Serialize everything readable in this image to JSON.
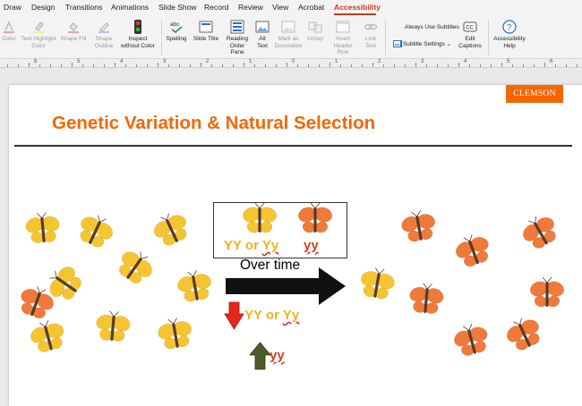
{
  "tabs": [
    "Draw",
    "Design",
    "Transitions",
    "Animations",
    "Slide Show",
    "Record",
    "Review",
    "View",
    "Acrobat",
    "Accessibility"
  ],
  "active_tab": "Accessibility",
  "ribbon": {
    "color_label": "Color",
    "text_highlight_color": "Text Highlight Color",
    "shape_fill": "Shape Fill",
    "shape_outline": "Shape Outline",
    "inspect_without_color": "Inspect without Color",
    "spelling": "Spelling",
    "spelling_icon_text": "abc",
    "slide_title": "Slide Title",
    "reading_order_pane": "Reading Order Pane",
    "alt_text": "Alt Text",
    "mark_as_decorative": "Mark as Decorative",
    "group": "Group",
    "insert_header_row": "Insert Header Row",
    "link_text": "Link Text",
    "always_use_subtitles": "Always Use Subtitles",
    "subtitle_settings": "Subtitle Settings",
    "edit_captions": "Edit Captions",
    "accessibility_help": "Accessibility Help"
  },
  "ruler_numbers": [
    "6",
    "5",
    "4",
    "3",
    "2",
    "1",
    "0",
    "1",
    "2",
    "3",
    "4",
    "5",
    "6"
  ],
  "slide": {
    "logo_text": "CLEMSON",
    "title": "Genetic Variation & Natural Selection",
    "box_label_1": "YY",
    "box_label_or": " or ",
    "box_label_2": "Yy",
    "box_label_3": "yy",
    "arrow_label": "Over time",
    "down_label_1": "YY",
    "down_label_or": " or ",
    "down_label_2": "Yy",
    "up_label": "yy"
  },
  "colors": {
    "accent": "#c43e1c",
    "clemson_orange": "#f56600",
    "yellow_butterfly": "#f5c531",
    "orange_butterfly": "#f07a3c",
    "down_arrow": "#e5281e",
    "up_arrow": "#4f5a29"
  }
}
